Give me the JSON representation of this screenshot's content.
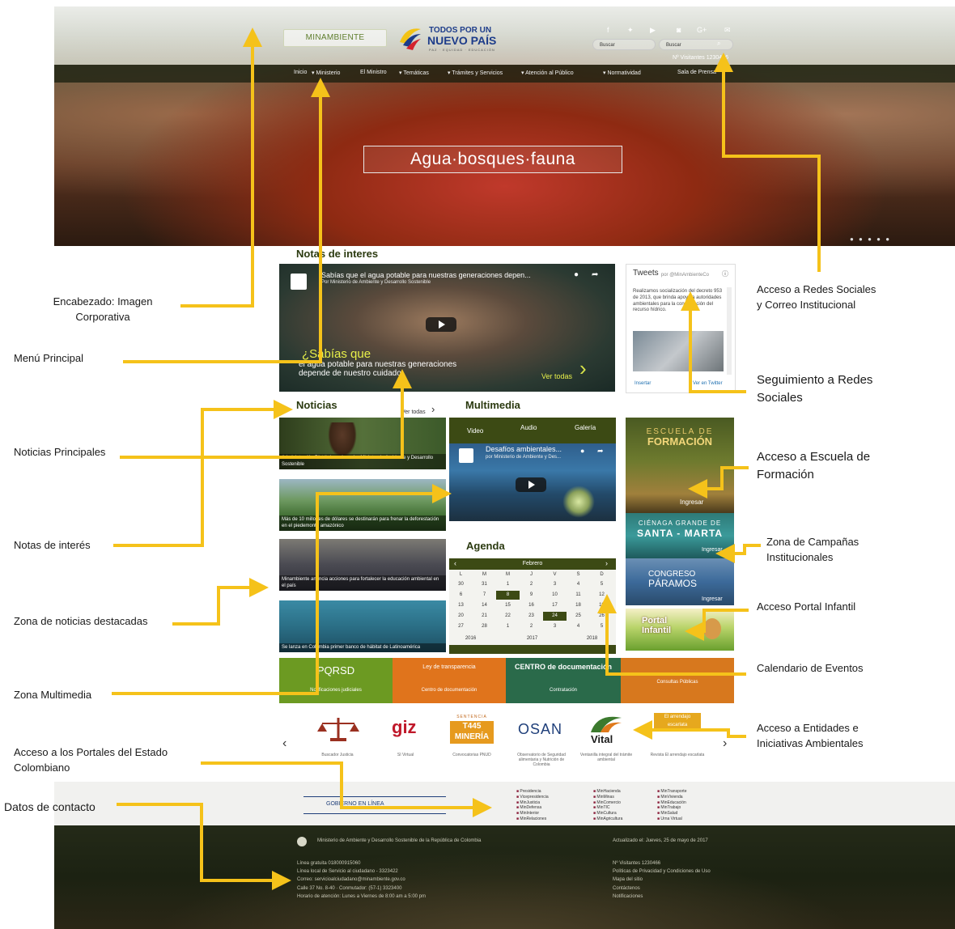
{
  "hero": {
    "logo_minambiente": "MINAMBIENTE",
    "logo_todos_line1": "TODOS POR UN",
    "logo_todos_line2": "NUEVO PAÍS",
    "logo_todos_line3": "PAZ · EQUIDAD · EDUCACIÓN",
    "search_placeholder_1": "Buscar",
    "search_placeholder_2": "Buscar",
    "visits": "Nº Visitantes 1230466",
    "slogan": "Agua·bosques·fauna",
    "social_icons": [
      "facebook-icon",
      "twitter-icon",
      "youtube-icon",
      "instagram-icon",
      "google-plus-icon",
      "mail-icon"
    ],
    "menu": [
      "Inicio",
      "Ministerio",
      "El Ministro",
      "Temáticas",
      "Trámites y Servicios",
      "Atención al Público",
      "Normatividad",
      "Sala de Prensa"
    ]
  },
  "content": {
    "notas_title": "Notas de interes",
    "video_title": "Sabías que el agua potable para nuestras generaciones depen...",
    "video_channel": "Por Ministerio de Ambiente y Desarrollo Sostenible",
    "video_caption_big": "¿Sabías que",
    "video_caption_small": "el agua potable para nuestras generaciones depende de nuestro cuidado.",
    "ver_todas": "Ver todas",
    "tweets_title": "Tweets",
    "tweets_by": "por @MinAmbienteCo",
    "tweet_text": "Realizamos socialización del decreto 953 de 2013, que brinda apoyo a autoridades ambientales para la conservación del recurso hídrico.",
    "tweets_insertar": "Insertar",
    "tweets_ver": "Ver en Twitter",
    "noticias_title": "Noticias",
    "noticias_ver": "Ver todas",
    "news": [
      "Administración Distrital condecoró a Ministro de Ambiente y Desarrollo Sostenible",
      "Más de 10 millones de dólares se destinarán para frenar la deforestación en el piedemonte amazónico",
      "Minambiente anuncia acciones para fortalecer la educación ambiental en el país",
      "Se lanza en Colombia primer banco de hábitat de Latinoamérica"
    ],
    "multimedia_title": "Multimedia",
    "multimedia_tabs": [
      "Video",
      "Audio",
      "Galería"
    ],
    "multi_video_title": "Desafíos ambientales...",
    "multi_video_channel": "por Ministerio de Ambiente y Des...",
    "agenda_title": "Agenda",
    "agenda_month": "Febrero",
    "agenda_days": [
      "L",
      "M",
      "M",
      "J",
      "V",
      "S",
      "D"
    ],
    "agenda_weeks": [
      [
        "30",
        "31",
        "1",
        "2",
        "3",
        "4",
        "5"
      ],
      [
        "6",
        "7",
        "8",
        "9",
        "10",
        "11",
        "12"
      ],
      [
        "13",
        "14",
        "15",
        "16",
        "17",
        "18",
        "19"
      ],
      [
        "20",
        "21",
        "22",
        "23",
        "24",
        "25",
        "26"
      ],
      [
        "27",
        "28",
        "1",
        "2",
        "3",
        "4",
        "5"
      ]
    ],
    "agenda_years": [
      "2016",
      "2017",
      "2018"
    ],
    "escuela_line1": "ESCUELA DE",
    "escuela_line2": "FORMACIÓN",
    "escuela_ingresar": "Ingresar",
    "cienaga_line1": "CIÉNAGA GRANDE DE",
    "cienaga_line2": "SANTA - MARTA",
    "cienaga_ingresar": "Ingresar",
    "paramos_line1": "CONGRESO",
    "paramos_line2": "PÁRAMOS",
    "paramos_ingresar": "Ingresar",
    "portal_infantil": "Portal Infantil",
    "banners": {
      "pqrsd": "PQRSD",
      "ley": "Ley de transparencia",
      "centro_doc": "CENTRO de documentación",
      "notificaciones": "Notificaciones judiciales",
      "centro_doc2": "Centro de documentación",
      "contratacion": "Contratación",
      "consultas": "Consultas Públicas"
    },
    "entities": [
      {
        "logo": "",
        "label": "Buscador Justicia"
      },
      {
        "logo": "giz",
        "label": "SI Virtual"
      },
      {
        "logo": "T445 MINERÍA",
        "label": "Convocatorias PNUD"
      },
      {
        "logo": "OSAN",
        "label": "Observatorio de Seguridad alimentaria y Nutrición de Colombia"
      },
      {
        "logo": "Vital",
        "label": "Ventanilla integral del trámite ambiental"
      },
      {
        "logo": "El arrendajo escarlata",
        "label": "Revista El arrendajo escarlata"
      }
    ],
    "entities_logo_tag": "SENTENCIA",
    "footer_links_col1": [
      "Presidencia",
      "Vicepresidencia",
      "MinJusticia",
      "MinDefensa",
      "MinInterior",
      "MinRelaciones"
    ],
    "footer_links_col2": [
      "MinHacienda",
      "MinMinas",
      "MinComercio",
      "MinTIC",
      "MinCultura",
      "MinAgricultura"
    ],
    "footer_links_col3": [
      "MinTransporte",
      "MinVivienda",
      "MinEducación",
      "MinTrabajo",
      "MinSalud",
      "Urna Virtual"
    ],
    "footer_gov": "GOBIERNO EN LÍNEA",
    "footer_ministry": "Ministerio de Ambiente y Desarrollo Sostenible de la República de Colombia",
    "footer_updated": "Actualizado el: Jueves, 25 de mayo de 2017",
    "footer_contact": [
      "Línea gratuita 018000915060",
      "Línea local de Servicio al ciudadano - 3323422",
      "Correo: servicioalciudadano@minambiente.gov.co",
      "Calle 37 No. 8-40 · Conmutador: (57-1) 3323400",
      "Horario de atención: Lunes a Viernes de 8:00 am a 5:00 pm"
    ],
    "footer_right": [
      "Nº Visitantes 1230466",
      "Políticas de Privacidad y Condiciones de Uso",
      "Mapa del sitio",
      "Contáctenos",
      "Notificaciones"
    ]
  },
  "annotations": {
    "encabezado": "Encabezado: Imagen Corporativa",
    "menu_principal": "Menú Principal",
    "noticias_principales": "Noticias Principales",
    "notas_interes": "Notas de interés",
    "zona_noticias": "Zona de noticias destacadas",
    "zona_multimedia": "Zona Multimedia",
    "portales_estado": "Acceso a los Portales del Estado Colombiano",
    "datos_contacto": "Datos de contacto",
    "redes_correo": "Acceso a Redes Sociales y Correo Institucional",
    "seguimiento_redes": "Seguimiento a Redes Sociales",
    "escuela_formacion": "Acceso a Escuela de Formación",
    "campanas": "Zona de Campañas Institucionales",
    "portal_infantil": "Acceso Portal Infantil",
    "calendario": "Calendario de Eventos",
    "entidades": "Acceso a Entidades e Iniciativas Ambientales"
  },
  "colors": {
    "arrow": "#f5c21a",
    "olive": "#3c4a14",
    "banner_green": "#5b8a1e",
    "banner_orange": "#e07a1c"
  }
}
